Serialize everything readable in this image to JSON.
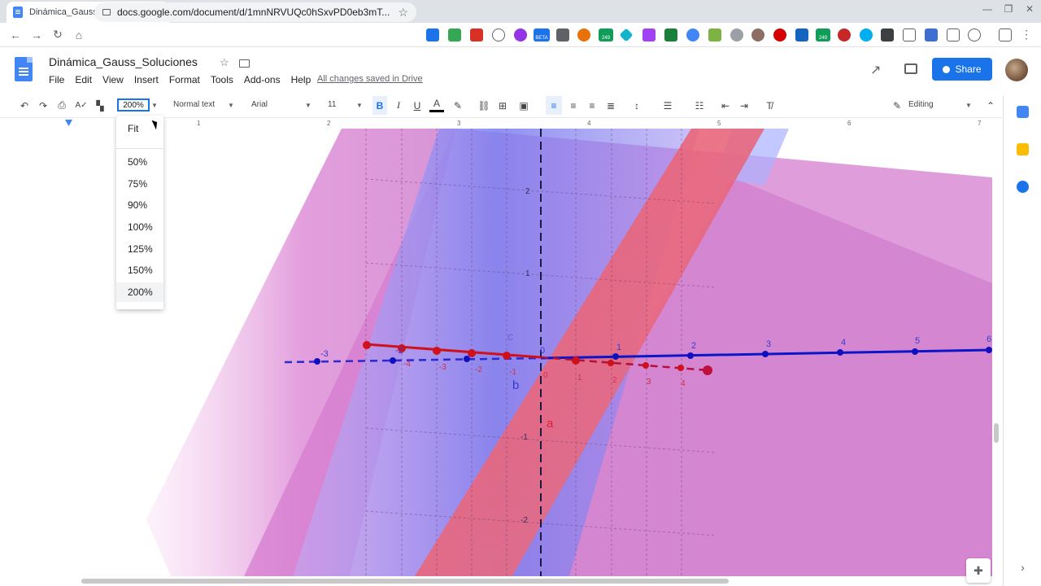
{
  "browser": {
    "tab_title": "Dinámica_Gauss_Soluciones - Go",
    "tab_close": "✕",
    "new_tab": "+",
    "url": "docs.google.com/document/d/1mnNRVUQc0hSxvPD0eb3mT...",
    "extension_beta_label": "BETA",
    "extension_badge_1": "249",
    "extension_badge_2": "249"
  },
  "doc": {
    "title": "Dinámica_Gauss_Soluciones",
    "menu": [
      "File",
      "Edit",
      "View",
      "Insert",
      "Format",
      "Tools",
      "Add-ons",
      "Help"
    ],
    "save_status": "All changes saved in Drive",
    "share_label": "Share"
  },
  "toolbar": {
    "zoom_value": "200%",
    "style_value": "Normal text",
    "font_value": "Arial",
    "size_value": "11",
    "mode_value": "Editing"
  },
  "ruler": {
    "numbers": [
      "1",
      "2",
      "3",
      "4",
      "5",
      "6",
      "7"
    ]
  },
  "zoom_menu": {
    "items": [
      "Fit",
      "50%",
      "75%",
      "90%",
      "100%",
      "125%",
      "150%",
      "200%"
    ],
    "selected": "200%"
  },
  "graph": {
    "axis_labels": [
      "-3",
      "-2",
      "-1",
      "0",
      "1",
      "2",
      "3",
      "4",
      "5",
      "6"
    ],
    "vertical_labels": [
      "2",
      "1",
      "-1",
      "-2"
    ],
    "point_labels": {
      "c": "c",
      "b": "b",
      "a": "a"
    },
    "red_line_labels": [
      "-4",
      "-3",
      "-2",
      "-1",
      "0",
      "1",
      "2",
      "3",
      "4"
    ]
  },
  "colors": {
    "brand_blue": "#1a73e8",
    "doc_blue": "#4285f4",
    "plane_magenta": "#d87ad0",
    "plane_blue": "#7b7ff0",
    "plane_red": "#e8606e",
    "axis_blue": "#0a16c8",
    "axis_red": "#d0101a"
  }
}
